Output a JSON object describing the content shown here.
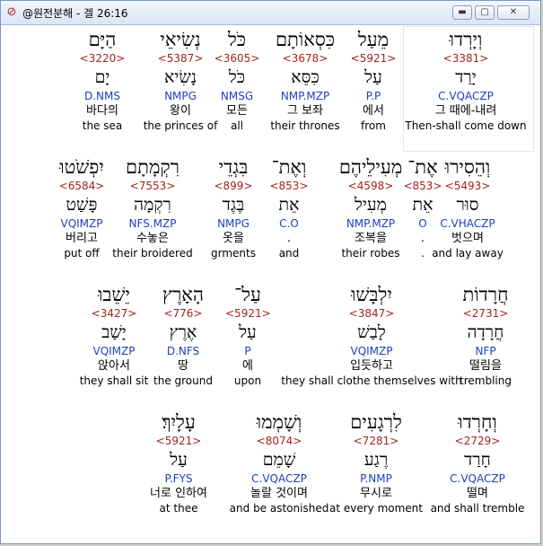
{
  "window": {
    "title": "@원전분해 - 겔 26:16",
    "icon": "app-logo-icon",
    "minimize_glyph": "▬",
    "maximize_glyph": "▢",
    "close_glyph": "✕"
  },
  "rows": [
    {
      "words": [
        {
          "heb": "וְיָרְדוּ",
          "num": "<3381>",
          "lemma": "יָרַד",
          "parse": "C.VQACZP",
          "kor": "그 때에-내려",
          "eng": "Then-shall come down"
        },
        {
          "heb": "מֵעַל",
          "num": "<5921>",
          "lemma": "עַל",
          "parse": "P.P",
          "kor": "에서",
          "eng": "from"
        },
        {
          "heb": "כִּסְאוֹתָם",
          "num": "<3678>",
          "lemma": "כִּסֵּא",
          "parse": "NMP.MZP",
          "kor": "그 보좌",
          "eng": "their thrones"
        },
        {
          "heb": "כֹּל",
          "num": "<3605>",
          "lemma": "כֹּל",
          "parse": "NMSG",
          "kor": "모든",
          "eng": "all"
        },
        {
          "heb": "נְשִׂיאֵי",
          "num": "<5387>",
          "lemma": "נָשִׂיא",
          "parse": "NMPG",
          "kor": "왕이",
          "eng": "the princes of"
        },
        {
          "heb": "הַיָּם",
          "num": "<3220>",
          "lemma": "יָם",
          "parse": "D.NMS",
          "kor": "바다의",
          "eng": "the sea"
        }
      ]
    },
    {
      "words": [
        {
          "heb": "וְהֵסִירוּ",
          "num": "<5493>",
          "lemma": "סוּר",
          "parse": "C.VHACZP",
          "kor": "벗으며",
          "eng": "and lay away"
        },
        {
          "heb": "אֶת־",
          "num": "<853>",
          "lemma": "אֵת",
          "parse": "O",
          "kor": ".",
          "eng": "."
        },
        {
          "heb": "מְעִילֵיהֶם",
          "num": "<4598>",
          "lemma": "מְעִיל",
          "parse": "NMP.MZP",
          "kor": "조복을",
          "eng": "their robes"
        },
        {
          "heb": "וְאֶת־",
          "num": "<853>",
          "lemma": "אֵת",
          "parse": "C.O",
          "kor": ".",
          "eng": "and"
        },
        {
          "heb": "בִּגְדֵי",
          "num": "<899>",
          "lemma": "בֶּגֶד",
          "parse": "NMPG",
          "kor": "옷을",
          "eng": "grments"
        },
        {
          "heb": "רִקְמָתָם",
          "num": "<7553>",
          "lemma": "רִקְמָה",
          "parse": "NFS.MZP",
          "kor": "수놓은",
          "eng": "their broidered"
        },
        {
          "heb": "יִפְשֹׁטוּ",
          "num": "<6584>",
          "lemma": "פָּשַׁט",
          "parse": "VQIMZP",
          "kor": "버리고",
          "eng": "put off"
        }
      ]
    },
    {
      "words": [
        {
          "heb": "חֲרָדוֹת",
          "num": "<2731>",
          "lemma": "חֲרָדָה",
          "parse": "NFP",
          "kor": "떨림을",
          "eng": "trembling"
        },
        {
          "heb": "יִלְבָּשׁוּ",
          "num": "<3847>",
          "lemma": "לָבַשׁ",
          "parse": "VQIMZP",
          "kor": "입듯하고",
          "eng": "they shall clothe themselves with"
        },
        {
          "heb": "עַל־",
          "num": "<5921>",
          "lemma": "עַל",
          "parse": "P",
          "kor": "에",
          "eng": "upon"
        },
        {
          "heb": "הָאָרֶץ",
          "num": "<776>",
          "lemma": "אֶרֶץ",
          "parse": "D.NFS",
          "kor": "땅",
          "eng": "the ground"
        },
        {
          "heb": "יֵשֵׁבוּ",
          "num": "<3427>",
          "lemma": "יָשַׁב",
          "parse": "VQIMZP",
          "kor": "앉아서",
          "eng": "they shall sit"
        }
      ]
    },
    {
      "words": [
        {
          "heb": "וְחָרְדוּ",
          "num": "<2729>",
          "lemma": "חָרַד",
          "parse": "C.VQACZP",
          "kor": "떨며",
          "eng": "and shall tremble"
        },
        {
          "heb": "לִרְגָעִים",
          "num": "<7281>",
          "lemma": "רֶגַע",
          "parse": "P.NMP",
          "kor": "무시로",
          "eng": "at every moment"
        },
        {
          "heb": "וְשָׁמְמוּ",
          "num": "<8074>",
          "lemma": "שָׁמֵם",
          "parse": "C.VQACZP",
          "kor": "놀랄 것이며",
          "eng": "and be astonished"
        },
        {
          "heb": "עָלָיִךְ׃",
          "num": "<5921>",
          "lemma": "עַל",
          "parse": "P.FYS",
          "kor": "너로 인하여",
          "eng": "at thee"
        }
      ]
    }
  ]
}
